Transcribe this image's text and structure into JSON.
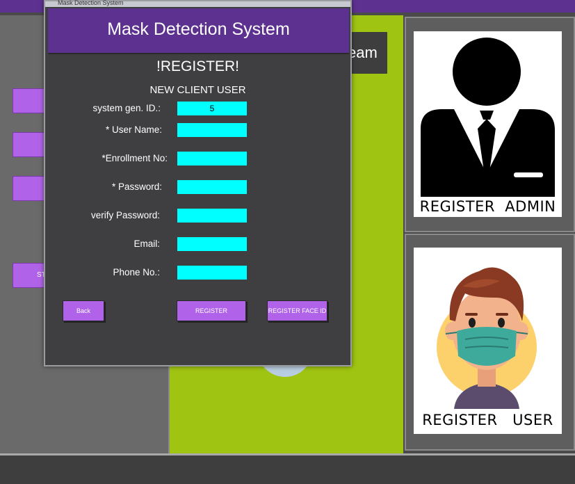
{
  "background_app": {
    "team_label": "eam",
    "left_buttons": [
      "",
      "",
      "",
      "ST"
    ]
  },
  "admin_card": {
    "label": "REGISTER  ADMIN",
    "icon": "admin-person-icon"
  },
  "user_card": {
    "label": "REGISTER   USER",
    "icon": "masked-user-icon"
  },
  "dialog": {
    "window_title": "Mask Detection System",
    "header_title": "Mask Detection System",
    "heading": "!REGISTER!",
    "subheading": "NEW CLIENT USER",
    "fields": {
      "system_id": {
        "label": "system gen. ID.:",
        "value": "5"
      },
      "user_name": {
        "label": "* User Name:",
        "value": ""
      },
      "enrollment_no": {
        "label": "*Enrollment No:",
        "value": ""
      },
      "password": {
        "label": "* Password:",
        "value": ""
      },
      "verify_password": {
        "label": "verify Password:",
        "value": ""
      },
      "email": {
        "label": "Email:",
        "value": ""
      },
      "phone": {
        "label": "Phone No.:",
        "value": ""
      }
    },
    "buttons": {
      "back": "Back",
      "register": "REGISTER",
      "register_face_id": "REGISTER FACE ID"
    }
  },
  "colors": {
    "purple_header": "#5d3190",
    "button_purple": "#b063e8",
    "input_cyan": "#00ffff",
    "center_green": "#9fc412",
    "dialog_bg": "#3f3e40"
  }
}
